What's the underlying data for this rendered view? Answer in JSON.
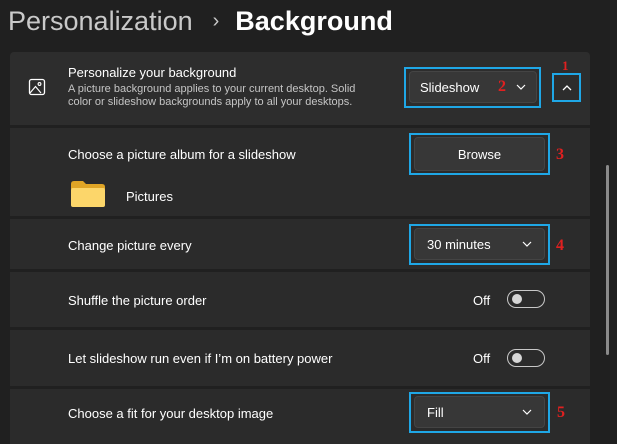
{
  "breadcrumb": {
    "parent": "Personalization",
    "separator": "›",
    "current": "Background"
  },
  "personalize": {
    "title": "Personalize your background",
    "desc_line1": "A picture background applies to your current desktop. Solid",
    "desc_line2": "color or slideshow backgrounds apply to all your desktops.",
    "dropdown_value": "Slideshow"
  },
  "album": {
    "label": "Choose a picture album for a slideshow",
    "browse_label": "Browse",
    "folder_name": "Pictures"
  },
  "change_picture": {
    "label": "Change picture every",
    "value": "30 minutes"
  },
  "shuffle": {
    "label": "Shuffle the picture order",
    "state": "Off"
  },
  "battery": {
    "label": "Let slideshow run even if I’m on battery power",
    "state": "Off"
  },
  "fit": {
    "label": "Choose a fit for your desktop image",
    "value": "Fill"
  },
  "annotations": [
    "1",
    "2",
    "3",
    "4",
    "5"
  ],
  "colors": {
    "highlight": "#1fa7e6",
    "annotation": "#e02020",
    "background": "#202020",
    "card": "#2b2b2b"
  },
  "icons": [
    "picture-icon",
    "chevron-down-icon",
    "chevron-up-icon",
    "folder-icon"
  ]
}
